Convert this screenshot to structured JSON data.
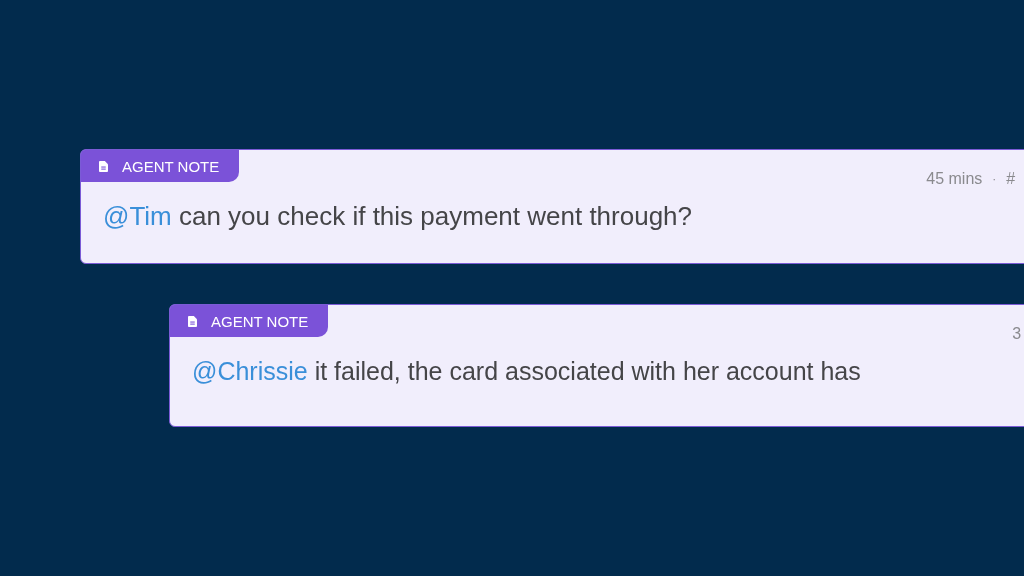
{
  "notes": [
    {
      "tag": "AGENT NOTE",
      "time": "45 mins",
      "separator": "·",
      "ref": "#",
      "mention": "@Tim",
      "text": "can you check if this payment went through?"
    },
    {
      "tag": "AGENT NOTE",
      "time": "3",
      "mention": "@Chrissie",
      "text": "it failed, the card associated with her account has"
    }
  ]
}
